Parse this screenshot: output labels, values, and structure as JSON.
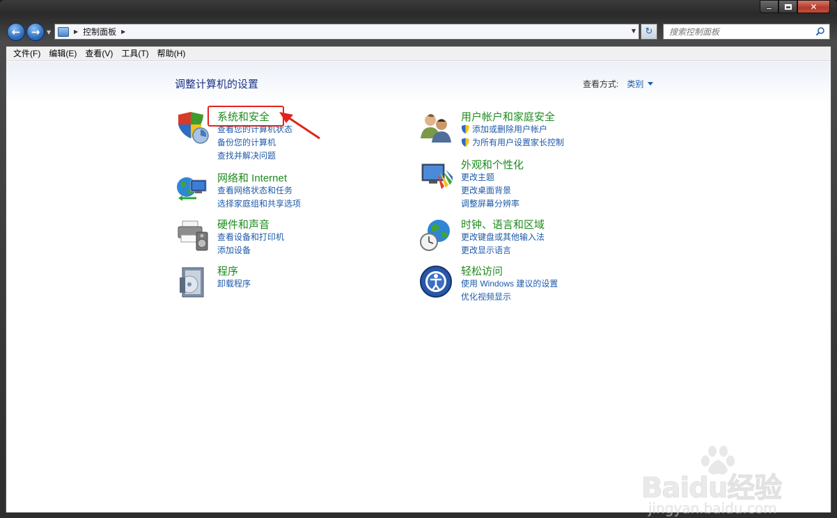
{
  "window": {
    "colors": {
      "close": "#c94e3c",
      "link": "#1e5aa8",
      "category": "#1e8a1e",
      "title": "#1e3287",
      "highlight": "#e0231d"
    }
  },
  "address": {
    "crumbs": [
      "控制面板"
    ],
    "search_placeholder": "搜索控制面板"
  },
  "menubar": {
    "items": [
      "文件(F)",
      "编辑(E)",
      "查看(V)",
      "工具(T)",
      "帮助(H)"
    ]
  },
  "main": {
    "title": "调整计算机的设置",
    "view_by_label": "查看方式:",
    "view_by_value": "类别"
  },
  "categories": [
    {
      "title": "系统和安全",
      "icon": "shield-icon",
      "links": [
        "查看您的计算机状态",
        "备份您的计算机",
        "查找并解决问题"
      ]
    },
    {
      "title": "网络和 Internet",
      "icon": "network-globe-icon",
      "links": [
        "查看网络状态和任务",
        "选择家庭组和共享选项"
      ]
    },
    {
      "title": "硬件和声音",
      "icon": "printer-speaker-icon",
      "links": [
        "查看设备和打印机",
        "添加设备"
      ]
    },
    {
      "title": "程序",
      "icon": "programs-disc-icon",
      "links": [
        "卸载程序"
      ]
    },
    {
      "title": "用户帐户和家庭安全",
      "icon": "users-icon",
      "links": [
        "添加或删除用户帐户",
        "为所有用户设置家长控制"
      ]
    },
    {
      "title": "外观和个性化",
      "icon": "monitor-palette-icon",
      "links": [
        "更改主题",
        "更改桌面背景",
        "调整屏幕分辨率"
      ]
    },
    {
      "title": "时钟、语言和区域",
      "icon": "clock-globe-icon",
      "links": [
        "更改键盘或其他输入法",
        "更改显示语言"
      ]
    },
    {
      "title": "轻松访问",
      "icon": "ease-of-access-icon",
      "links": [
        "使用 Windows 建议的设置",
        "优化视频显示"
      ]
    }
  ],
  "watermark": {
    "text": "Baidu经验",
    "url": "jingyan.baidu.com"
  }
}
